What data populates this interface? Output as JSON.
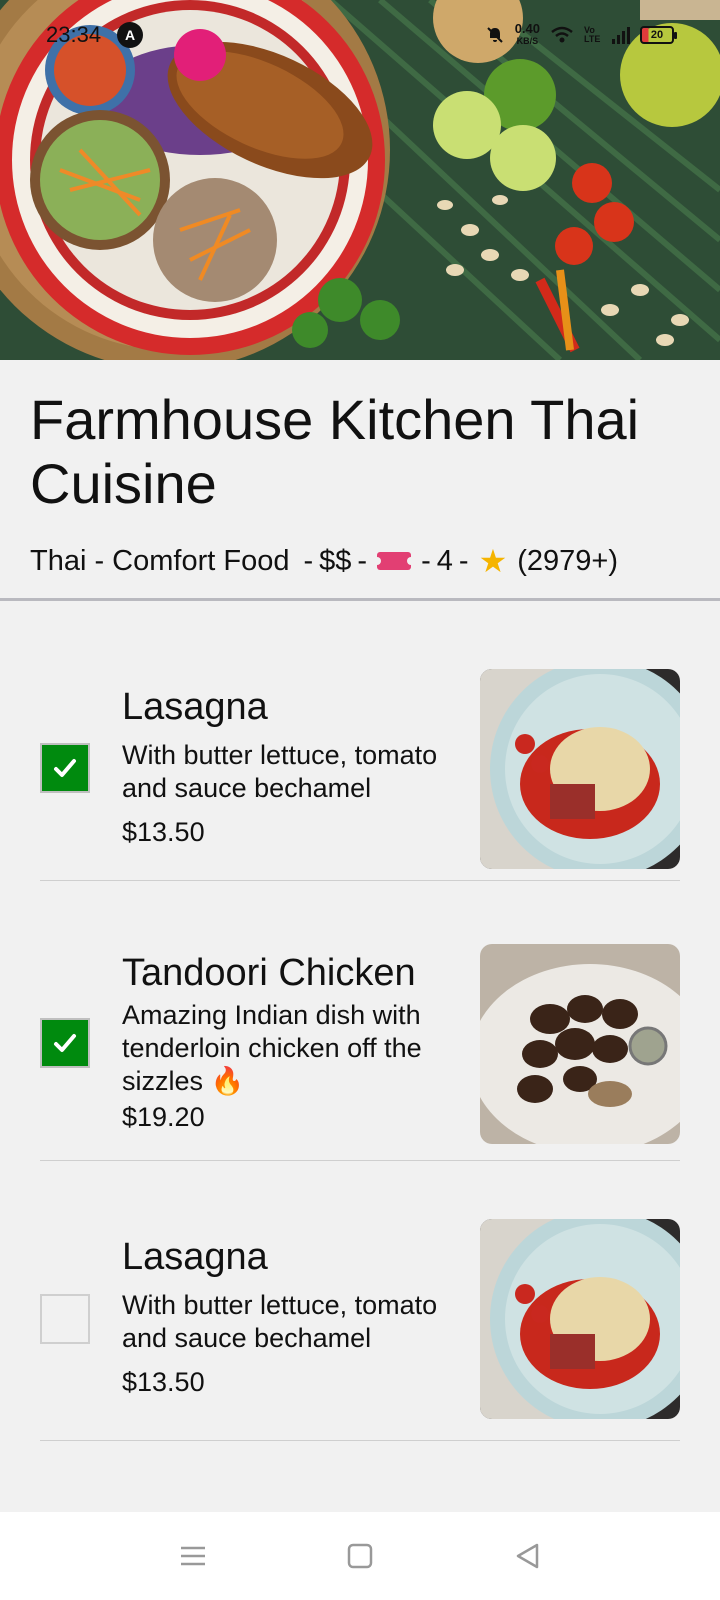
{
  "status_bar": {
    "time": "23:34",
    "app_icon_letter": "A",
    "net_speed_value": "0.40",
    "net_speed_unit": "KB/S",
    "volte": "Vo LTE",
    "battery_level": "20"
  },
  "restaurant": {
    "name": "Farmhouse Kitchen Thai Cuisine",
    "cuisine": "Thai - Comfort Food",
    "price_range": "$$",
    "rating": "4",
    "review_count": "(2979+)",
    "separator": "-"
  },
  "menu_items": [
    {
      "name": "Lasagna",
      "description": "With butter lettuce, tomato and sauce bechamel",
      "price": "$13.50",
      "selected": true
    },
    {
      "name": "Tandoori Chicken",
      "description": "Amazing Indian dish with tenderloin chicken off the sizzles 🔥",
      "price": "$19.20",
      "selected": true
    },
    {
      "name": "Lasagna",
      "description": "With butter lettuce, tomato and sauce bechamel",
      "price": "$13.50",
      "selected": false
    }
  ],
  "colors": {
    "checkbox_checked": "#008a0e",
    "background": "#f1f1f1",
    "ticket": "#e23f73"
  },
  "icons": {
    "menu": "menu-icon",
    "home": "home-icon",
    "back": "back-icon"
  }
}
